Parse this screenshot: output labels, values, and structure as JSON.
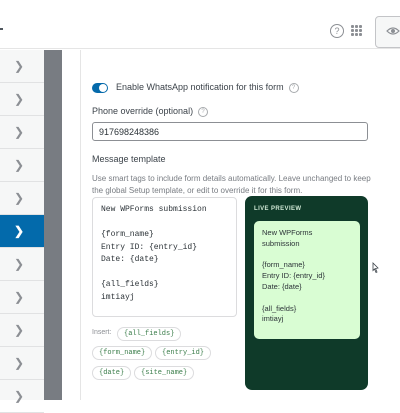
{
  "topbar": {
    "icons": [
      "help-icon",
      "apps-grid-icon",
      "eye-icon"
    ],
    "help_glyph": "?"
  },
  "sidebar": {
    "items": [
      {
        "icon": "chevron-right-icon",
        "active": false
      },
      {
        "icon": "chevron-right-icon",
        "active": false
      },
      {
        "icon": "chevron-right-icon",
        "active": false
      },
      {
        "icon": "chevron-right-icon",
        "active": false
      },
      {
        "icon": "chevron-right-icon",
        "active": false
      },
      {
        "icon": "chevron-right-icon",
        "active": true
      },
      {
        "icon": "chevron-right-icon",
        "active": false
      },
      {
        "icon": "chevron-right-icon",
        "active": false
      },
      {
        "icon": "chevron-right-icon",
        "active": false
      },
      {
        "icon": "chevron-right-icon",
        "active": false
      },
      {
        "icon": "chevron-right-icon",
        "active": false
      }
    ],
    "active_color": "#036aab"
  },
  "settings": {
    "whatsapp_toggle": {
      "label": "Enable WhatsApp notification for this form",
      "enabled": true,
      "accent": "#056aab"
    },
    "phone_override": {
      "label": "Phone override (optional)",
      "value": "917698248386"
    },
    "message_template": {
      "label": "Message template",
      "description": "Use smart tags to include form details automatically. Leave unchanged to keep the global Setup template, or edit to override it for this form.",
      "value": "New WPForms submission\n\n{form_name}\nEntry ID: {entry_id}\nDate: {date}\n\n{all_fields}\nimtiayj"
    },
    "insert": {
      "label": "Insert:",
      "tags": [
        "{all_fields}",
        "{form_name}",
        "{entry_id}",
        "{date}",
        "{site_name}"
      ]
    }
  },
  "live_preview": {
    "title": "LIVE PREVIEW",
    "message": "New WPForms\nsubmission\n\n{form_name}\nEntry ID: {entry_id}\nDate: {date}\n\n{all_fields}\nimtiayj",
    "background": "#0f3a29",
    "bubble_color": "#d9fdd3"
  }
}
